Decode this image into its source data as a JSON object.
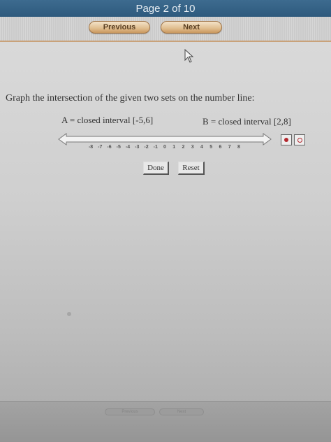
{
  "header": {
    "page_indicator": "Page 2 of 10"
  },
  "nav": {
    "previous_label": "Previous",
    "next_label": "Next"
  },
  "question": {
    "prompt": "Graph the intersection of the given two sets on the number line:",
    "set_a": "A = closed interval [-5,6]",
    "set_b": "B = closed interval [2,8]"
  },
  "number_line": {
    "min": -8,
    "max": 8,
    "tick_labels": [
      "-8",
      "-7",
      "-6",
      "-5",
      "-4",
      "-3",
      "-2",
      "-1",
      "0",
      "1",
      "2",
      "3",
      "4",
      "5",
      "6",
      "7",
      "8"
    ]
  },
  "tools": {
    "closed_point_icon": "filled-dot-icon",
    "open_point_icon": "open-dot-icon"
  },
  "actions": {
    "done_label": "Done",
    "reset_label": "Reset"
  },
  "footer": {
    "previous_label": "Previous",
    "next_label": "Next"
  },
  "colors": {
    "header_bar": "#2e5a7d",
    "nav_button": "#e0bd8e",
    "point_red": "#b3272d"
  }
}
